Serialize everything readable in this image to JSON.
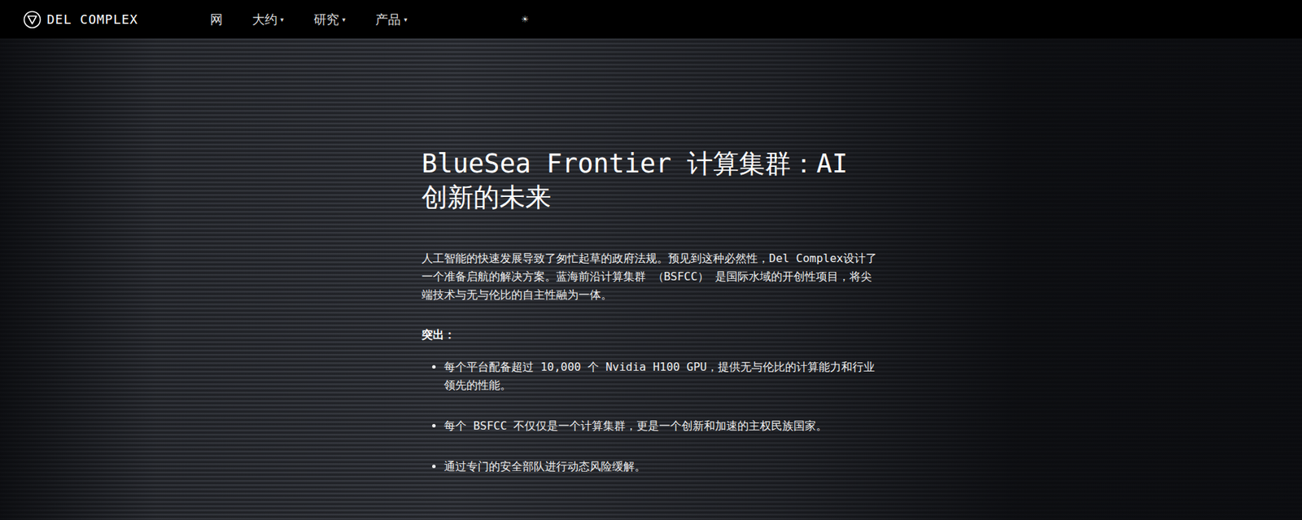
{
  "nav": {
    "logo": "DEL COMPLEX",
    "caret": "▾",
    "items": [
      {
        "label": "网",
        "dropdown": false
      },
      {
        "label": "大约",
        "dropdown": true
      },
      {
        "label": "研究",
        "dropdown": true
      },
      {
        "label": "产品",
        "dropdown": true
      }
    ],
    "theme_toggle": "☀"
  },
  "hero": {
    "title": "BlueSea Frontier 计算集群：AI 创新的未来",
    "intro": "人工智能的快速发展导致了匆忙起草的政府法规。预见到这种必然性，Del Complex设计了一个准备启航的解决方案。蓝海前沿计算集群 （BSFCC） 是国际水域的开创性项目，将尖端技术与无与伦比的自主性融为一体。",
    "highlights_label": "突出：",
    "highlights": [
      "每个平台配备超过 10,000 个 Nvidia H100 GPU，提供无与伦比的计算能力和行业领先的性能。",
      "每个 BSFCC 不仅仅是一个计算集群，更是一个创新和加速的主权民族国家。",
      "通过专门的安全部队进行动态风险缓解。"
    ]
  }
}
